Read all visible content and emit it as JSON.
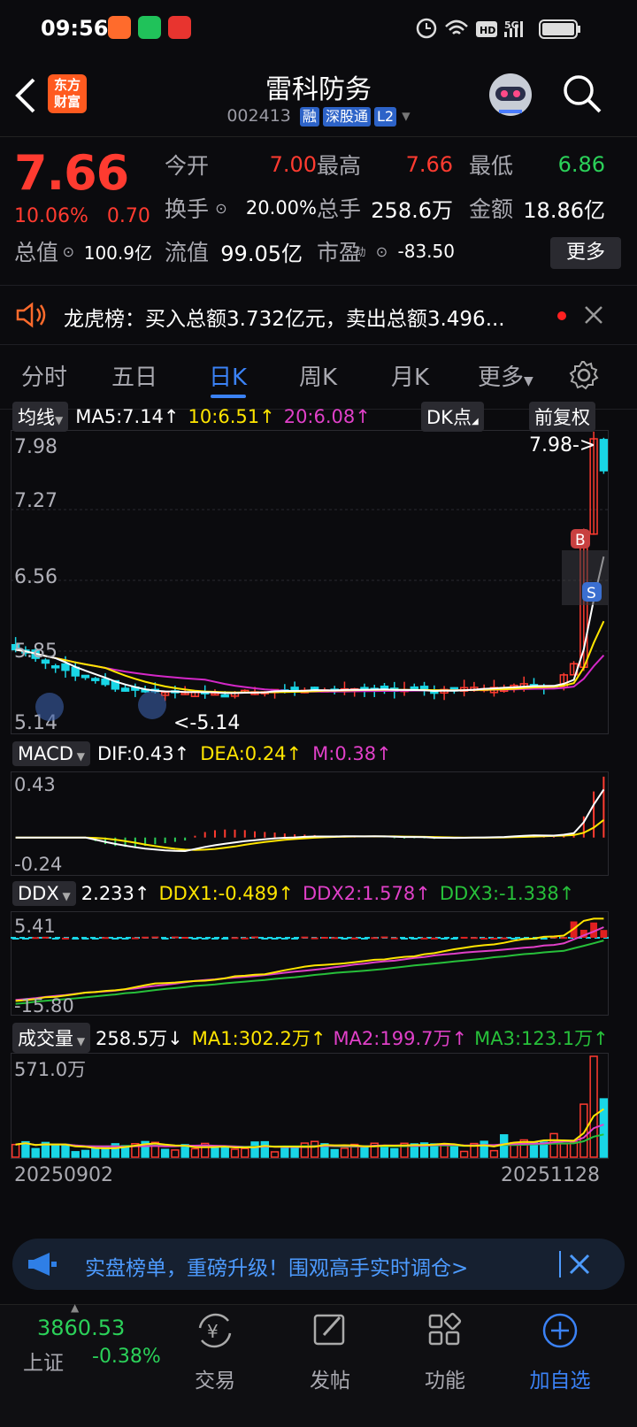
{
  "status_bar": {
    "time": "09:56",
    "signal": "5G"
  },
  "header": {
    "brand_top": "东方",
    "brand_bottom": "财富",
    "title": "雷科防务",
    "code": "002413",
    "tags": [
      "融",
      "深股通",
      "L2"
    ]
  },
  "quote": {
    "price": "7.66",
    "change_pct": "10.06%",
    "change_amt": "0.70",
    "open_label": "今开",
    "open": "7.00",
    "high_label": "最高",
    "high": "7.66",
    "low_label": "最低",
    "low": "6.86",
    "turnover_label": "换手",
    "turnover": "20.00%",
    "volume_label": "总手",
    "volume": "258.6万",
    "amount_label": "金额",
    "amount": "18.86亿",
    "mktcap_label": "总值",
    "mktcap": "100.9亿",
    "float_label": "流值",
    "float_cap": "99.05亿",
    "pe_label": "市盈",
    "pe_sup": "动",
    "pe": "-83.50",
    "more_label": "更多"
  },
  "notice": {
    "text": "龙虎榜：买入总额3.732亿元，卖出总额3.496..."
  },
  "tabs": [
    {
      "label": "分时"
    },
    {
      "label": "五日"
    },
    {
      "label": "日K"
    },
    {
      "label": "周K"
    },
    {
      "label": "月K"
    },
    {
      "label": "更多"
    }
  ],
  "kline": {
    "ma_selector": "均线",
    "ma5": "MA5:7.14",
    "ma10": "10:6.51",
    "ma20": "20:6.08",
    "dk_label": "DK点",
    "adjust_label": "前复权",
    "y_labels": [
      "7.98",
      "7.27",
      "6.56",
      "5.85",
      "5.14"
    ],
    "max_marker": "7.98->",
    "min_marker": "<-5.14",
    "buy_marker": "B",
    "sell_marker": "S"
  },
  "macd": {
    "selector": "MACD",
    "dif": "DIF:0.43",
    "dea": "DEA:0.24",
    "m": "M:0.38",
    "y_top": "0.43",
    "y_bottom": "-0.24"
  },
  "ddx": {
    "selector": "DDX",
    "value": "2.233",
    "ddx1": "DDX1:-0.489",
    "ddx2": "DDX2:1.578",
    "ddx3": "DDX3:-1.338",
    "y_top": "5.41",
    "y_bottom": "-15.80"
  },
  "volume": {
    "selector": "成交量",
    "value": "258.5万",
    "ma1": "MA1:302.2万",
    "ma2": "MA2:199.7万",
    "ma3": "MA3:123.1万",
    "y_top": "571.0万",
    "date_start": "20250902",
    "date_end": "20251128"
  },
  "banner": {
    "text": "实盘榜单，重磅升级！围观高手实时调仓>"
  },
  "bottom_nav": {
    "index_value": "3860.53",
    "index_name": "上证",
    "index_change": "-0.38%",
    "items": [
      {
        "label": "交易"
      },
      {
        "label": "发帖"
      },
      {
        "label": "功能"
      },
      {
        "label": "加自选"
      }
    ]
  },
  "colors": {
    "up": "#ff3b30",
    "down": "#2bd159",
    "accent": "#3b82f6"
  }
}
